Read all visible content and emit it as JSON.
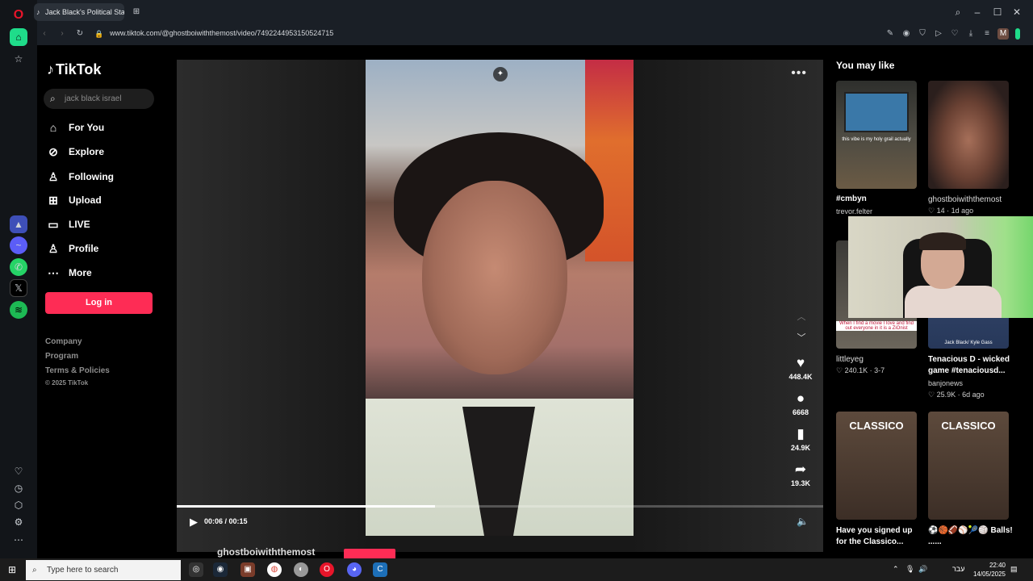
{
  "browser": {
    "tab_title": "Jack Black's Political Stanc",
    "url": "www.tiktok.com/@ghostboiwiththemost/video/7492244953150524715",
    "profile_initial": "M"
  },
  "tiktok": {
    "logo_text": "TikTok",
    "search_placeholder": "jack black israel",
    "nav": [
      {
        "label": "For You",
        "icon": "home-icon"
      },
      {
        "label": "Explore",
        "icon": "compass-icon"
      },
      {
        "label": "Following",
        "icon": "following-icon"
      },
      {
        "label": "Upload",
        "icon": "upload-icon"
      },
      {
        "label": "LIVE",
        "icon": "live-icon"
      },
      {
        "label": "Profile",
        "icon": "profile-icon"
      },
      {
        "label": "More",
        "icon": "more-icon"
      }
    ],
    "login_label": "Log in",
    "footer": {
      "company": "Company",
      "program": "Program",
      "terms": "Terms & Policies",
      "copyright": "© 2025 TikTok"
    }
  },
  "video": {
    "likes": "448.4K",
    "comments": "6668",
    "saves": "24.9K",
    "shares": "19.3K",
    "time": "00:06 / 00:15",
    "progress": 0.4,
    "author": "ghostboiwiththemost"
  },
  "sidebar": {
    "heading": "You may like",
    "cards": [
      {
        "title": "#cmbyn",
        "author": "trevor.felter",
        "stats": "",
        "thumb_caption": "this vibe is my holy grail actually"
      },
      {
        "title": "",
        "author": "ghostboiwiththemost",
        "stats": "♡ 14 · 1d ago",
        "thumb_caption": ""
      },
      {
        "title": "",
        "author": "littleyeg",
        "stats": "♡ 240.1K · 3-7",
        "thumb_caption": "When I find a movie I love and find out everyone in it is a ZiOnist"
      },
      {
        "title": "Tenacious D - wicked game #tenaciousd...",
        "author": "banjonews",
        "stats": "♡ 25.9K · 6d ago",
        "thumb_caption": "Jack Black/ Kyle Gass"
      },
      {
        "title": "Have you signed up for the Classico...",
        "author": "",
        "stats": "",
        "thumb_caption": "CLASSICO"
      },
      {
        "title": "⚽🏀🏈⚾🎾🏐 Balls! ......",
        "author": "",
        "stats": "",
        "thumb_caption": "CLASSICO"
      }
    ]
  },
  "taskbar": {
    "search_placeholder": "Type here to search",
    "lang": "עבר",
    "time": "22:40",
    "date": "14/05/2025"
  },
  "colors": {
    "accent": "#fe2c55",
    "opera": "#e8152a",
    "sidebar_green": "#1fdc8a"
  }
}
